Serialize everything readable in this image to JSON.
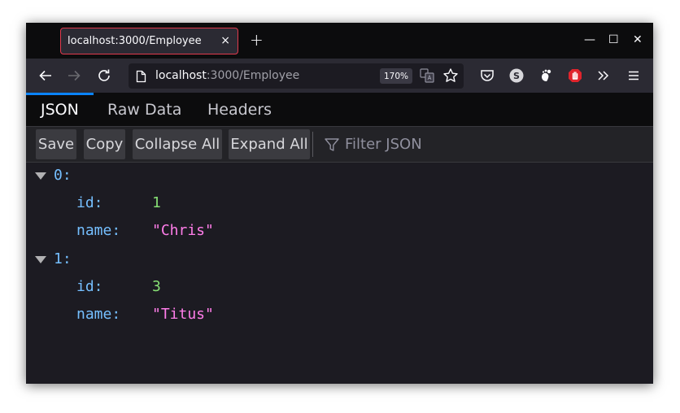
{
  "browser": {
    "tab_title": "localhost:3000/Employee",
    "tab_close": "×",
    "new_tab": "+",
    "window_controls": {
      "minimize": "—",
      "maximize": "☐",
      "close": "✕"
    },
    "url_host": "localhost",
    "url_path": ":3000/Employee",
    "zoom": "170%"
  },
  "viewer": {
    "tabs": [
      {
        "label": "JSON",
        "active": true
      },
      {
        "label": "Raw Data",
        "active": false
      },
      {
        "label": "Headers",
        "active": false
      }
    ],
    "toolbar": {
      "save": "Save",
      "copy": "Copy",
      "collapse_all": "Collapse All",
      "expand_all": "Expand All",
      "filter_placeholder": "Filter JSON"
    }
  },
  "json": {
    "items": [
      {
        "index": "0:",
        "id_key": "id:",
        "id_value": "1",
        "name_key": "name:",
        "name_value": "\"Chris\""
      },
      {
        "index": "1:",
        "id_key": "id:",
        "id_value": "3",
        "name_key": "name:",
        "name_value": "\"Titus\""
      }
    ]
  },
  "colors": {
    "accent": "#0a84ff",
    "tab_border": "#e0394d",
    "json_key": "#75bfff",
    "json_number": "#86de74",
    "json_string": "#ff7de9"
  }
}
